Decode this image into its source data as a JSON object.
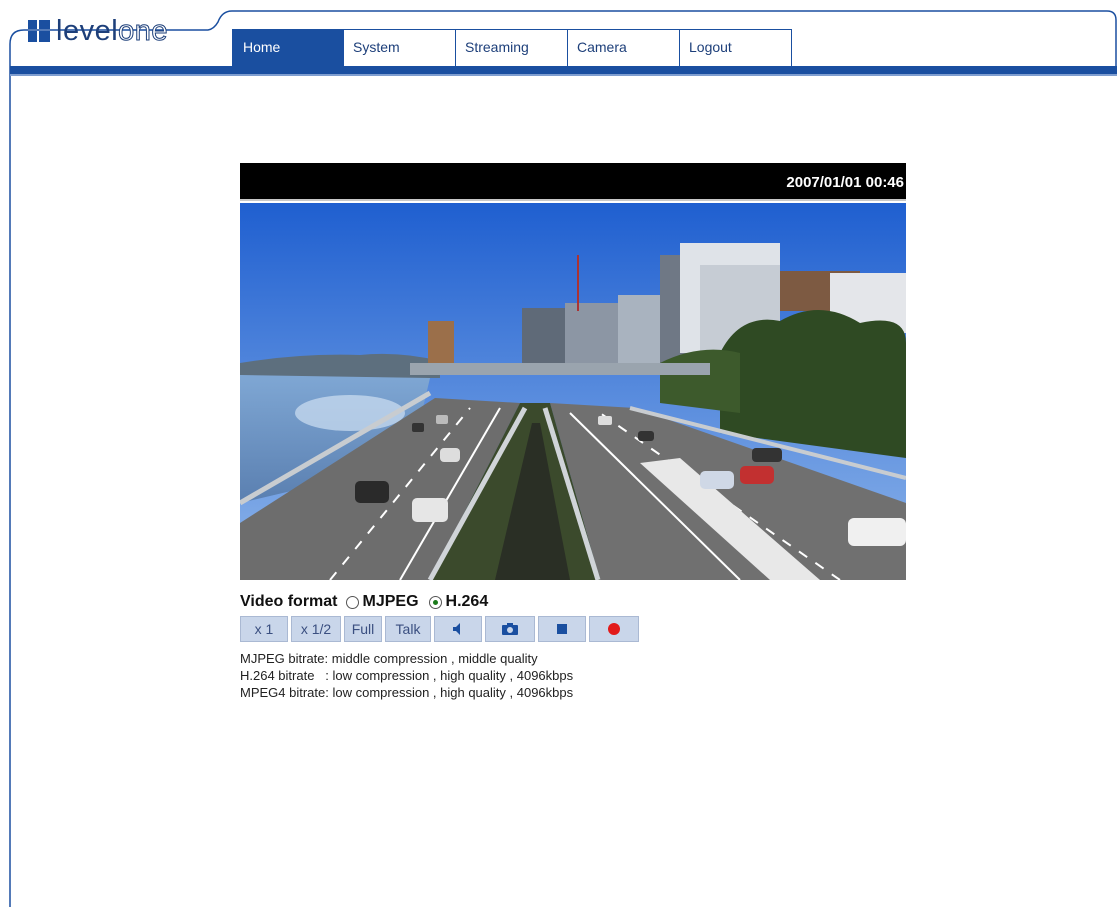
{
  "brand": {
    "logo_text_dark": "level",
    "logo_text_light": "one"
  },
  "nav": {
    "tabs": [
      {
        "label": "Home",
        "active": true
      },
      {
        "label": "System",
        "active": false
      },
      {
        "label": "Streaming",
        "active": false
      },
      {
        "label": "Camera",
        "active": false
      },
      {
        "label": "Logout",
        "active": false
      }
    ]
  },
  "video": {
    "timestamp": "2007/01/01 00:46",
    "scene_icon": "traffic-camera-feed"
  },
  "format": {
    "label": "Video format",
    "options": [
      {
        "label": "MJPEG",
        "selected": false
      },
      {
        "label": "H.264",
        "selected": true
      }
    ]
  },
  "controls": {
    "zoom_1x": "x 1",
    "zoom_half": "x 1/2",
    "full": "Full",
    "talk": "Talk",
    "icons": [
      "speaker-icon",
      "camera-snapshot-icon",
      "stop-icon",
      "record-icon"
    ]
  },
  "bitrate_info": [
    "MJPEG bitrate: middle compression , middle quality",
    "H.264 bitrate   : low compression , high quality , 4096kbps",
    "MPEG4 bitrate: low compression , high quality , 4096kbps"
  ],
  "colors": {
    "brand_blue": "#1a4fa0",
    "button_bg": "#c9d6ea",
    "record_red": "#e21a1a"
  }
}
